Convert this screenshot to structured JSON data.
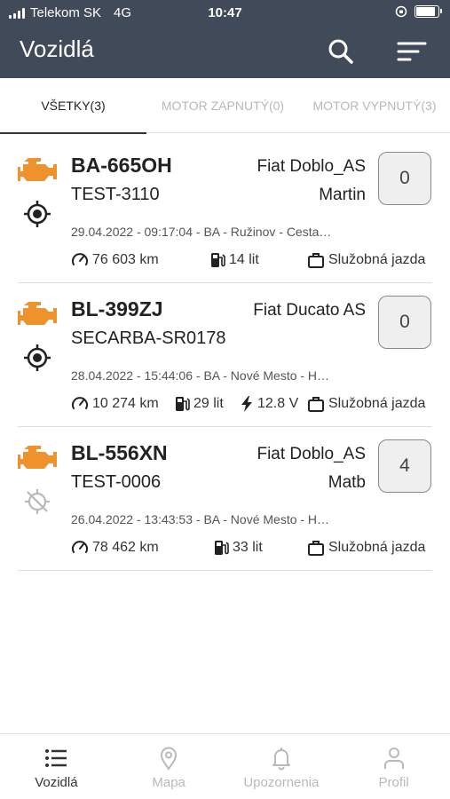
{
  "status_bar": {
    "carrier": "Telekom SK",
    "network": "4G",
    "time": "10:47",
    "battery_level": 0.9
  },
  "header": {
    "title": "Vozidlá",
    "search_icon": "search-icon",
    "filter_icon": "filter-lines-icon"
  },
  "tabs": [
    {
      "label": "VŠETKY(3)",
      "active": true
    },
    {
      "label": "MOTOR ZAPNUTÝ(0)",
      "active": false
    },
    {
      "label": "MOTOR VYPNUTÝ(3)",
      "active": false
    }
  ],
  "colors": {
    "header_bg": "#414a59",
    "engine_orange": "#f0922b",
    "inactive_gray": "#b9b9b9"
  },
  "vehicles": [
    {
      "plate": "BA-665OH",
      "model": "Fiat Doblo_AS",
      "id": "TEST-3110",
      "driver": "Martin",
      "count": "0",
      "location": "29.04.2022 - 09:17:04 - BA - Ružinov - Cesta…",
      "mileage": "76 603 km",
      "fuel": "14 lit",
      "voltage": "",
      "trip_type": "Služobná jazda",
      "gps_status": "gps-fix"
    },
    {
      "plate": "BL-399ZJ",
      "model": "Fiat Ducato AS",
      "id": "SECARBA-SR0178",
      "driver": "",
      "count": "0",
      "location": "28.04.2022 - 15:44:06 - BA - Nové Mesto - H…",
      "mileage": "10 274 km",
      "fuel": "29 lit",
      "voltage": "12.8 V",
      "trip_type": "Služobná jazda",
      "gps_status": "gps-fix"
    },
    {
      "plate": "BL-556XN",
      "model": "Fiat Doblo_AS",
      "id": "TEST-0006",
      "driver": "Matb",
      "count": "4",
      "location": "26.04.2022 - 13:43:53 - BA - Nové Mesto - H…",
      "mileage": "78 462 km",
      "fuel": "33 lit",
      "voltage": "",
      "trip_type": "Služobná jazda",
      "gps_status": "gps-off"
    }
  ],
  "bottom_nav": [
    {
      "label": "Vozidlá",
      "icon": "list-icon",
      "active": true
    },
    {
      "label": "Mapa",
      "icon": "map-pin-icon",
      "active": false
    },
    {
      "label": "Upozornenia",
      "icon": "bell-icon",
      "active": false
    },
    {
      "label": "Profil",
      "icon": "user-icon",
      "active": false
    }
  ]
}
